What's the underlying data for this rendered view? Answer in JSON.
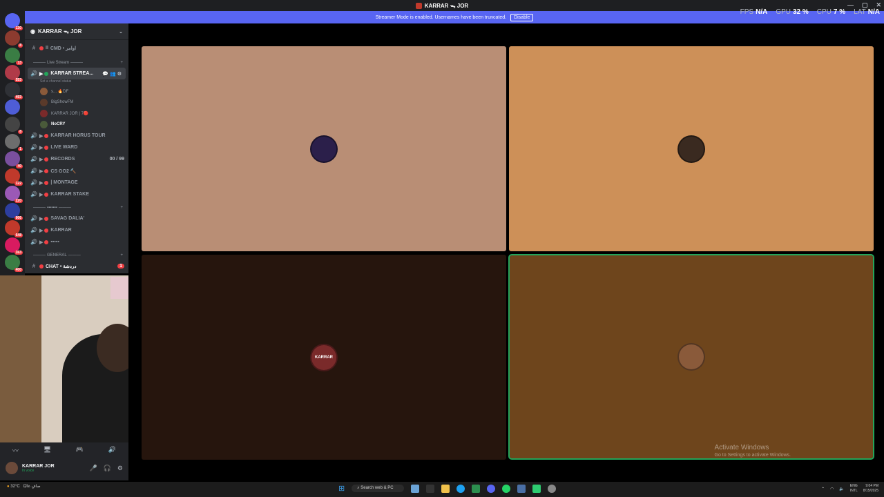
{
  "window": {
    "title": "KARRAR ᯓ JOR"
  },
  "banner": {
    "text": "Streamer Mode is enabled. Usernames have been truncated.",
    "button": "Disable"
  },
  "stats": [
    {
      "label": "FPS",
      "value": "N/A"
    },
    {
      "label": "GPU",
      "value": "32 %"
    },
    {
      "label": "CPU",
      "value": "7 %"
    },
    {
      "label": "LAT",
      "value": "N/A"
    }
  ],
  "servers": [
    {
      "color": "#5865f2",
      "badge": "130"
    },
    {
      "color": "#8c3b2f",
      "badge": "8"
    },
    {
      "color": "#3a7d44",
      "badge": "13"
    },
    {
      "color": "#b03a48",
      "badge": "553"
    },
    {
      "color": "#2f3136",
      "badge": "493"
    },
    {
      "color": "#4e5dd6",
      "badge": ""
    },
    {
      "color": "#444",
      "badge": "8"
    },
    {
      "color": "#6d6d6d",
      "badge": "1"
    },
    {
      "color": "#7a4f9e",
      "badge": "40"
    },
    {
      "color": "#c0392b",
      "badge": "122"
    },
    {
      "color": "#9b59b6",
      "badge": "220"
    },
    {
      "color": "#2d3e9e",
      "badge": "906"
    },
    {
      "color": "#c0392b",
      "badge": "648"
    },
    {
      "color": "#d81b60",
      "badge": "163"
    },
    {
      "color": "#3a7d44",
      "badge": "400"
    }
  ],
  "guild": {
    "name": "KARRAR ᯓ JOR"
  },
  "channels": {
    "top": {
      "name": "CMD • اوامر",
      "prefix": "II"
    },
    "live_category": "Live Stream",
    "active": {
      "name": "KARRAR STREA...",
      "status": "Set a channel status"
    },
    "voice_users": [
      "s... 🔥DF",
      "BigShowFM",
      "KARRAR JOR | 7🔴",
      "NoCRY"
    ],
    "voice_channels": [
      {
        "name": "KARRAR HORUS TOUR",
        "right": ""
      },
      {
        "name": "LIVE WARD",
        "right": ""
      },
      {
        "name": "RECORDS",
        "right": "00 / 99"
      },
      {
        "name": "CS GO2 🔨",
        "right": ""
      },
      {
        "name": "| MONTAGE",
        "right": ""
      },
      {
        "name": "KARRAR STAKE",
        "right": ""
      }
    ],
    "category2": "▪▪▪▪▪▪▪",
    "more_voice": [
      {
        "name": "SAVAG DALIA'"
      },
      {
        "name": "KARRAR"
      },
      {
        "name": "▪▪▪▪▪"
      }
    ],
    "category3": "GENERAL",
    "chat": {
      "name": "CHAT • دردشة",
      "badge": "1"
    }
  },
  "user": {
    "name": "KARRAR JOR",
    "status": "In voice"
  },
  "tiles": [
    {
      "color": "#b98e75",
      "avatar_color": "#2b1f4a",
      "label": ""
    },
    {
      "color": "#cd9058",
      "avatar_color": "#3a2a20",
      "label": ""
    },
    {
      "color": "#26150d",
      "avatar_color": "#7a2a2a",
      "label": "KARRAR"
    },
    {
      "color": "#6e451c",
      "avatar_color": "#8a5a3a",
      "label": ""
    }
  ],
  "watermark": {
    "title": "Activate Windows",
    "sub": "Go to Settings to activate Windows."
  },
  "taskbar": {
    "weather": "32°C",
    "weather_sub": "صافٍ غالبًا",
    "search": "Search web & PC",
    "lang": "ENG",
    "region": "INTL",
    "time": "9:04 PM",
    "date": "8/15/2025"
  }
}
